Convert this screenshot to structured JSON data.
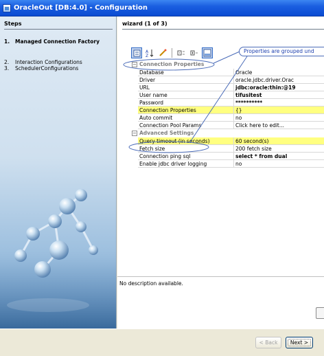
{
  "window": {
    "title": "OracleOut [DB:4.0] - Configuration"
  },
  "steps": {
    "header": "Steps",
    "items": [
      {
        "num": "1.",
        "label": "Managed Connection Factory",
        "active": true
      },
      {
        "num": "2.",
        "label": "Interaction Configurations",
        "active": false
      },
      {
        "num": "3.",
        "label": "SchedulerConfigurations",
        "active": false
      }
    ]
  },
  "wizard": {
    "title": "wizard (1 of 3)"
  },
  "toolbar": {
    "buttons": [
      "categorized-icon",
      "sort-alpha-icon",
      "edit-wand-icon",
      "expand-icon",
      "collapse-icon",
      "show-description-icon"
    ]
  },
  "callout": {
    "text": "Properties are grouped und"
  },
  "groups": [
    {
      "label": "Connection Properties",
      "rows": [
        {
          "name": "Database",
          "value": "Oracle",
          "highlight": false,
          "bold": false
        },
        {
          "name": "Driver",
          "value": "oracle.jdbc.driver.Orac",
          "highlight": false,
          "bold": false
        },
        {
          "name": "URL",
          "value": "jdbc:oracle:thin:@19",
          "highlight": false,
          "bold": true
        },
        {
          "name": "User name",
          "value": "tifusitest",
          "highlight": false,
          "bold": true
        },
        {
          "name": "Password",
          "value": "**********",
          "highlight": false,
          "bold": true
        },
        {
          "name": "Connection Properties",
          "value": "{}",
          "highlight": true,
          "bold": false
        },
        {
          "name": "Auto commit",
          "value": "no",
          "highlight": false,
          "bold": false
        },
        {
          "name": "Connection Pool Params",
          "value": "Click here to edit...",
          "highlight": false,
          "bold": false
        }
      ]
    },
    {
      "label": "Advanced Settings",
      "rows": [
        {
          "name": "Query timeout (in seconds)",
          "value": "60 second(s)",
          "highlight": true,
          "bold": false
        },
        {
          "name": "Fetch size",
          "value": "200 fetch size",
          "highlight": false,
          "bold": false
        },
        {
          "name": "Connection ping sql",
          "value": "select * from dual",
          "highlight": false,
          "bold": true
        },
        {
          "name": "Enable jdbc driver logging",
          "value": "no",
          "highlight": false,
          "bold": false
        }
      ]
    }
  ],
  "description": {
    "text": "No description available."
  },
  "buttons": {
    "back": "< Back",
    "next": "Next >"
  },
  "colors": {
    "titlebar": "#0a4bd2",
    "highlight": "#ffff80",
    "callout": "#1c3fae"
  }
}
